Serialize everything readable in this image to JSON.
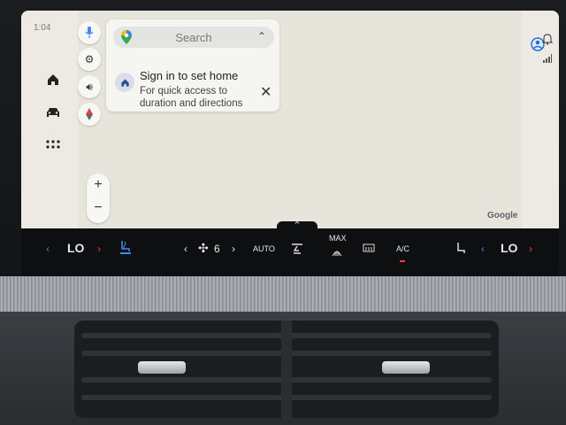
{
  "status": {
    "time": "1:04"
  },
  "search": {
    "placeholder": "Search"
  },
  "home_card": {
    "title": "Sign in to set home",
    "subtitle": "For quick access to duration and directions"
  },
  "map": {
    "attribution": "Google"
  },
  "zoom": {
    "in_label": "+",
    "out_label": "−"
  },
  "climate": {
    "left_temp": "LO",
    "fan_speed": "6",
    "auto_label": "AUTO",
    "max_label": "MAX",
    "ac_label": "A/C",
    "right_temp": "LO"
  },
  "colors": {
    "accent_blue": "#3b8ce6",
    "accent_red": "#e0443b",
    "map_bg": "#e7e5db"
  },
  "icons": [
    "microphone-icon",
    "gear-icon",
    "speaker-icon",
    "compass-icon",
    "home-icon",
    "car-icon",
    "apps-grid-icon",
    "account-icon",
    "bell-icon",
    "signal-icon",
    "maps-pin-icon",
    "fan-icon",
    "seat-heat-icon",
    "defrost-icon"
  ]
}
